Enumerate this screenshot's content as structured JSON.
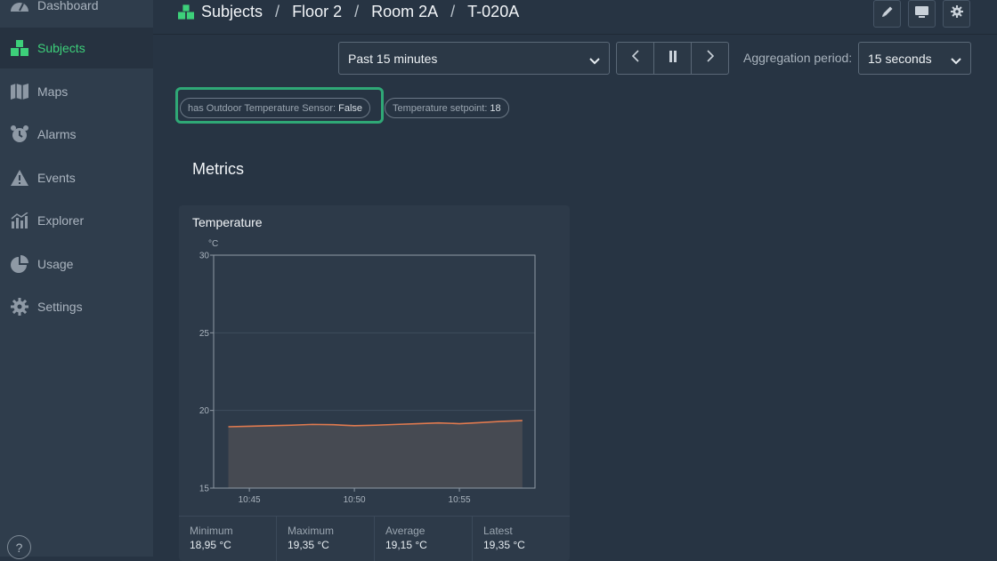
{
  "sidebar": {
    "items": [
      {
        "label": "Dashboard",
        "icon": "gauge-icon"
      },
      {
        "label": "Subjects",
        "icon": "subjects-cubes-icon",
        "active": true
      },
      {
        "label": "Maps",
        "icon": "map-icon"
      },
      {
        "label": "Alarms",
        "icon": "alarm-clock-icon"
      },
      {
        "label": "Events",
        "icon": "warning-icon"
      },
      {
        "label": "Explorer",
        "icon": "bar-chart-icon"
      },
      {
        "label": "Usage",
        "icon": "pie-chart-icon"
      },
      {
        "label": "Settings",
        "icon": "gear-icon"
      }
    ],
    "help": "?"
  },
  "breadcrumb": [
    "Subjects",
    "Floor 2",
    "Room 2A",
    "T-020A"
  ],
  "breadcrumb_separator": "/",
  "controls": {
    "time_range": "Past 15 minutes",
    "aggregation_label": "Aggregation period:",
    "aggregation_value": "15 seconds"
  },
  "chips": [
    {
      "label": "has Outdoor Temperature Sensor:",
      "value": "False",
      "highlighted": true
    },
    {
      "label": "Temperature setpoint:",
      "value": "18"
    }
  ],
  "metrics_title": "Metrics",
  "colors": {
    "accent": "#3dd07a",
    "line": "#e07a4f",
    "highlight": "#2fa876"
  },
  "chart_data": {
    "type": "area",
    "title": "Temperature",
    "ylabel": "°C",
    "ylim": [
      15,
      30
    ],
    "yticks": [
      15,
      20,
      25,
      30
    ],
    "xticks": [
      "10:45",
      "10:50",
      "10:55"
    ],
    "x": [
      "10:44",
      "10:45",
      "10:46",
      "10:47",
      "10:48",
      "10:49",
      "10:50",
      "10:51",
      "10:52",
      "10:53",
      "10:54",
      "10:55",
      "10:56",
      "10:57",
      "10:58"
    ],
    "series": [
      {
        "values": [
          18.95,
          18.98,
          19.02,
          19.05,
          19.1,
          19.08,
          19.02,
          19.05,
          19.1,
          19.15,
          19.2,
          19.15,
          19.22,
          19.3,
          19.35
        ]
      }
    ],
    "grid": true,
    "stats": [
      {
        "label": "Minimum",
        "value": "18,95 °C"
      },
      {
        "label": "Maximum",
        "value": "19,35 °C"
      },
      {
        "label": "Average",
        "value": "19,15 °C"
      },
      {
        "label": "Latest",
        "value": "19,35 °C"
      }
    ]
  }
}
